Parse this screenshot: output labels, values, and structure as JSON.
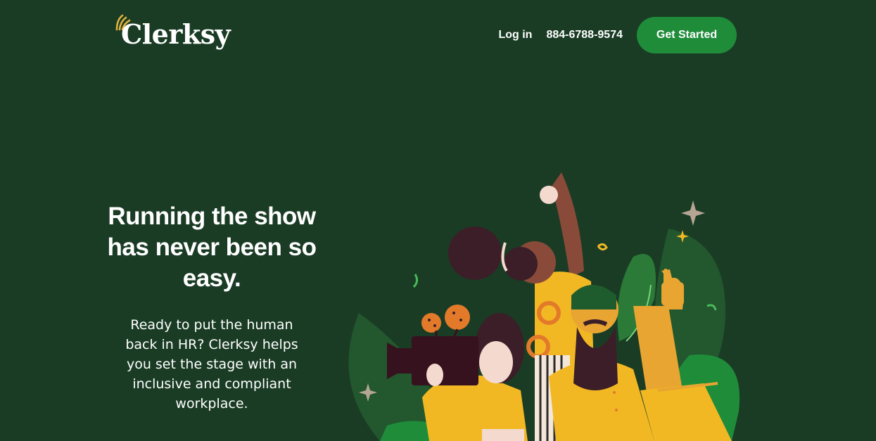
{
  "header": {
    "logo_text": "Clerksy",
    "nav": {
      "login_label": "Log in",
      "phone": "884-6788-9574",
      "cta_label": "Get Started"
    }
  },
  "hero": {
    "title": "Running the show has never been so easy.",
    "subtitle": "Ready to put the human back in HR? Clerksy helps you set the stage with an inclusive and compliant workplace."
  },
  "colors": {
    "background": "#1a3c25",
    "cta": "#1f8c3a",
    "accent_yellow": "#f2b824",
    "logo_rays": "#e3b23c"
  }
}
